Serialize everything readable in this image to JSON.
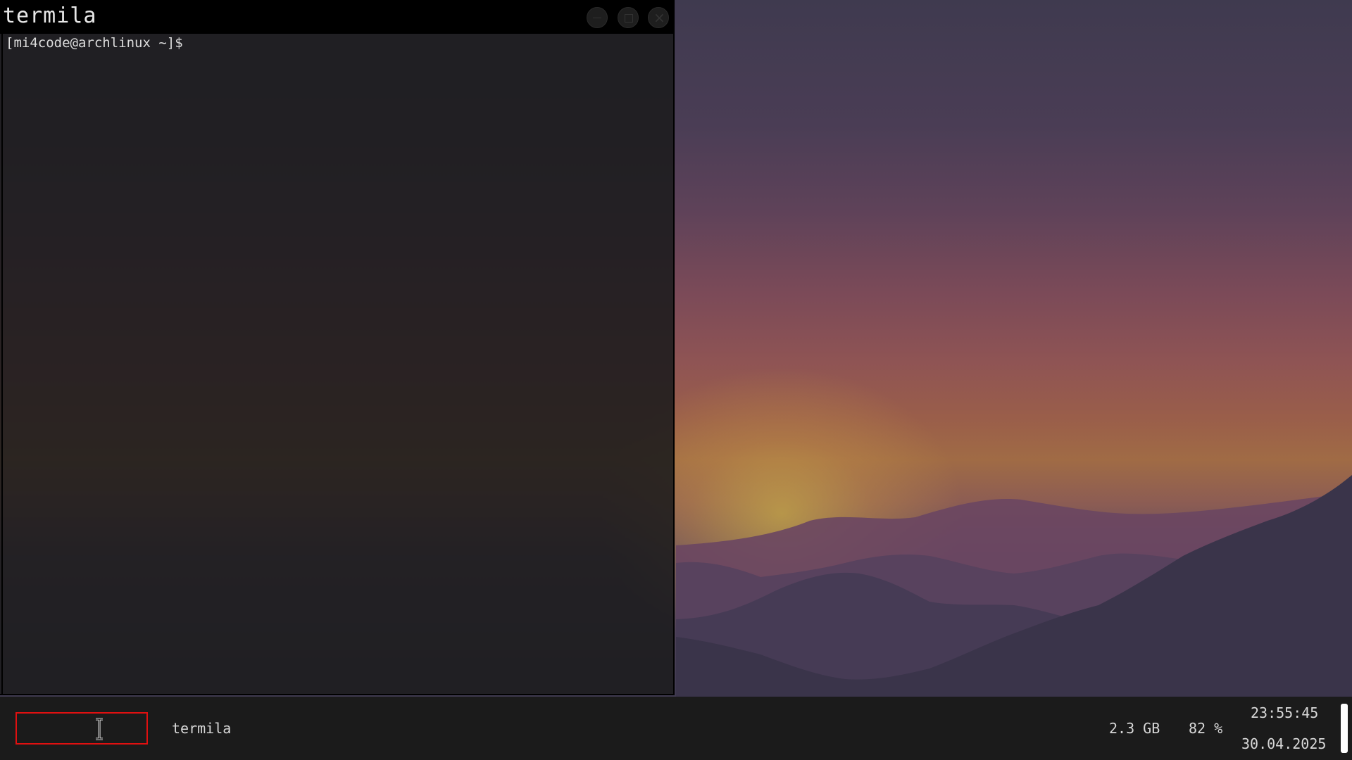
{
  "window": {
    "title": "termila",
    "prompt": "[mi4code@archlinux ~]$"
  },
  "taskbar": {
    "launcher_value": "",
    "task_label": "termila",
    "memory": "2.3 GB",
    "battery": "82 %",
    "time": "23:55:45",
    "date": "30.04.2025"
  },
  "icons": {
    "minimize": "minimize-icon",
    "maximize": "maximize-icon",
    "close": "close-icon",
    "cursor": "text-cursor-icon"
  },
  "colors": {
    "launcher_border": "#e01010",
    "titlebar": "#000000",
    "taskbar": "#1b1b1b"
  }
}
